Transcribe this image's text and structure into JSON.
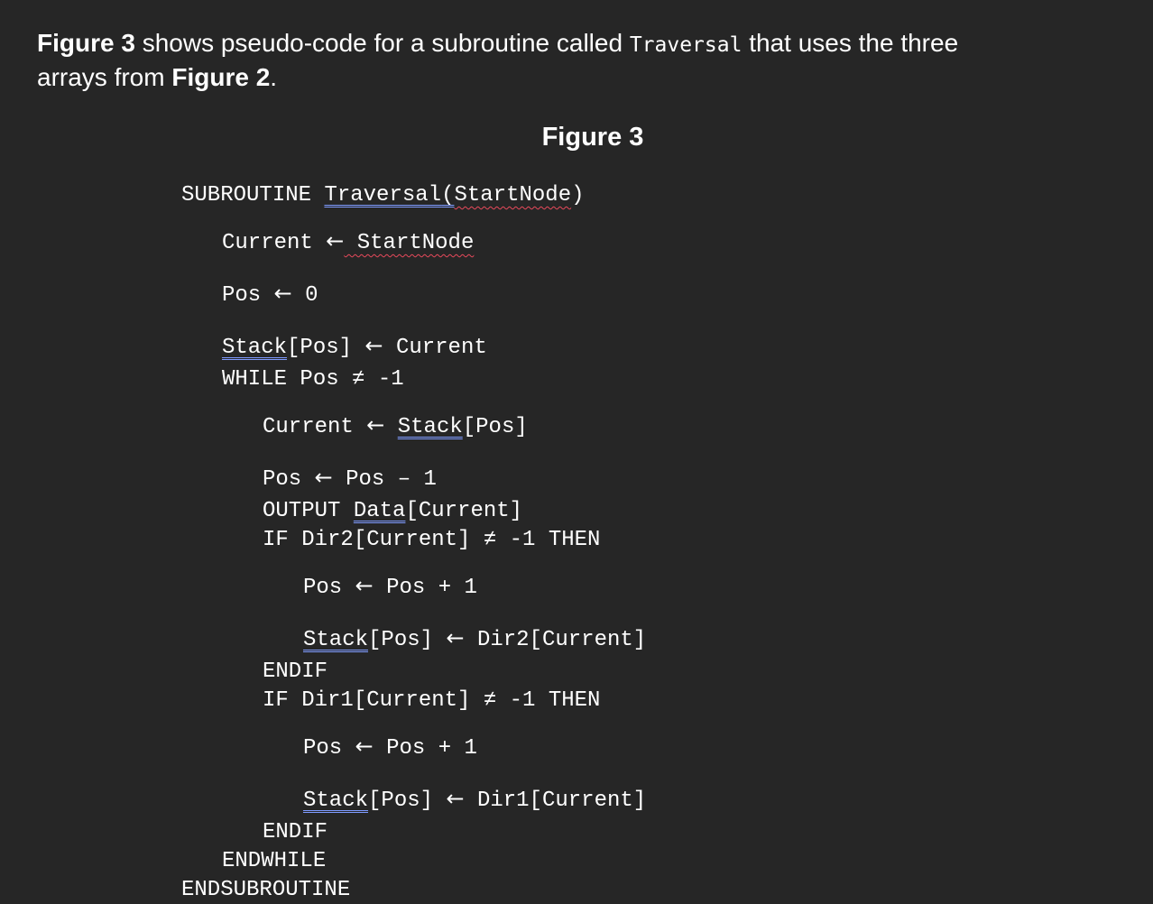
{
  "intro": {
    "figure_ref_1": "Figure 3",
    "text_1": " shows pseudo-code for a subroutine called ",
    "subroutine_name": "Traversal",
    "text_2": " that uses the three",
    "text_3": "arrays from ",
    "figure_ref_2": "Figure 2",
    "text_4": "."
  },
  "figure_title": "Figure 3",
  "code": {
    "l1_kw": "SUBROUTINE ",
    "l1_name": "Traversal",
    "l1_paren_open": "(",
    "l1_param": "StartNode",
    "l1_paren_close": ")",
    "l2_lhs": "Current ",
    "l2_arrow": "←",
    "l2_rhs": " StartNode",
    "l3_lhs": "Pos ",
    "l3_arrow": "←",
    "l3_rhs": " 0",
    "l4_lhs": "Stack",
    "l4_idx": "[Pos] ",
    "l4_arrow": "←",
    "l4_rhs": " Current",
    "l5": "WHILE Pos ≠ -1",
    "l6_lhs": "Current ",
    "l6_arrow": "←",
    "l6_sp": " ",
    "l6_rhs": "Stack",
    "l6_idx": "[Pos]",
    "l7_lhs": "Pos ",
    "l7_arrow": "←",
    "l7_rhs": " Pos – 1",
    "l8_kw": "OUTPUT ",
    "l8_arr": "Data",
    "l8_idx": "[Current]",
    "l9": "IF Dir2[Current] ≠ -1 THEN",
    "l10_lhs": "Pos ",
    "l10_arrow": "←",
    "l10_rhs": " Pos + 1",
    "l11_lhs": "Stack",
    "l11_idx": "[Pos] ",
    "l11_arrow": "←",
    "l11_rhs": " Dir2[Current]",
    "l12": "ENDIF",
    "l13": "IF Dir1[Current] ≠ -1 THEN",
    "l14_lhs": "Pos ",
    "l14_arrow": "←",
    "l14_rhs": " Pos + 1",
    "l15_lhs": "Stack",
    "l15_idx": "[Pos] ",
    "l15_arrow": "←",
    "l15_rhs": " Dir1[Current]",
    "l16": "ENDIF",
    "l17": "ENDWHILE",
    "l18": "ENDSUBROUTINE"
  },
  "colors": {
    "background": "#262626",
    "text": "#ffffff",
    "grammar_underline": "#7f9bff",
    "spelling_underline": "#e8495b"
  }
}
